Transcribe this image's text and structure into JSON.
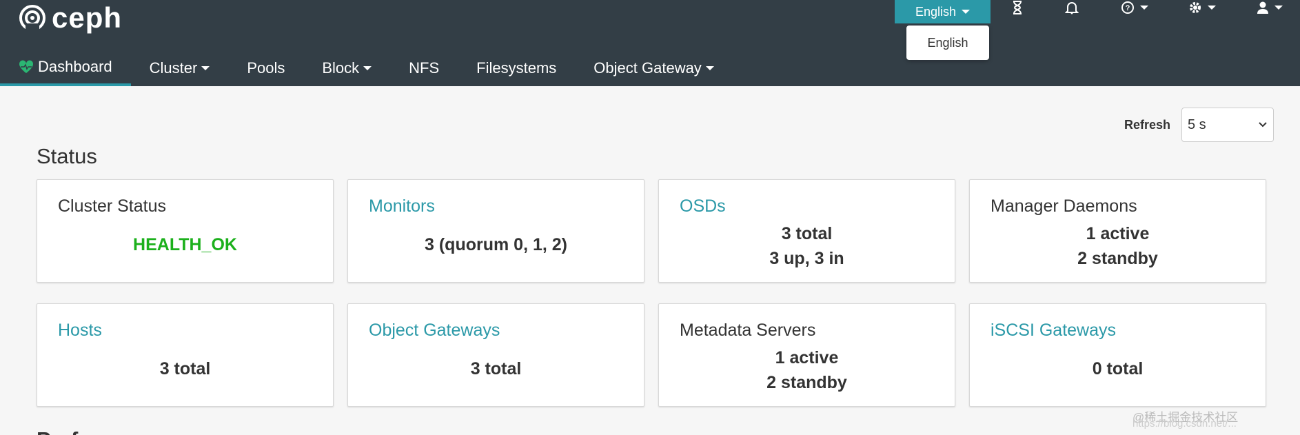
{
  "brand": {
    "name": "ceph"
  },
  "topbar": {
    "language_button": "English",
    "language_menu_item": "English",
    "icons": [
      "hourglass-icon",
      "bell-icon",
      "help-icon",
      "gear-icon",
      "user-icon"
    ]
  },
  "nav": {
    "items": [
      {
        "label": "Dashboard",
        "active": true
      },
      {
        "label": "Cluster",
        "dropdown": true
      },
      {
        "label": "Pools"
      },
      {
        "label": "Block",
        "dropdown": true
      },
      {
        "label": "NFS"
      },
      {
        "label": "Filesystems"
      },
      {
        "label": "Object Gateway",
        "dropdown": true
      }
    ]
  },
  "refresh": {
    "label": "Refresh",
    "value": "5 s"
  },
  "status": {
    "title": "Status",
    "cards": [
      {
        "title": "Cluster Status",
        "lines": [
          "HEALTH_OK"
        ]
      },
      {
        "title": "Monitors",
        "lines": [
          "3 (quorum 0, 1, 2)"
        ]
      },
      {
        "title": "OSDs",
        "lines": [
          "3 total",
          "3 up, 3 in"
        ]
      },
      {
        "title": "Manager Daemons",
        "lines": [
          "1 active",
          "2 standby"
        ]
      },
      {
        "title": "Hosts",
        "lines": [
          "3 total"
        ]
      },
      {
        "title": "Object Gateways",
        "lines": [
          "3 total"
        ]
      },
      {
        "title": "Metadata Servers",
        "lines": [
          "1 active",
          "2 standby"
        ]
      },
      {
        "title": "iSCSI Gateways",
        "lines": [
          "0 total"
        ]
      }
    ]
  },
  "next_section": {
    "title": "Perf"
  },
  "watermark": {
    "text": "@稀土掘金技术社区",
    "url": "https://blog.csdn.net/..."
  },
  "colors": {
    "navbar": "#333e46",
    "accent": "#2b99a8",
    "ok": "#1cb01c",
    "background": "#f6f6f6"
  }
}
